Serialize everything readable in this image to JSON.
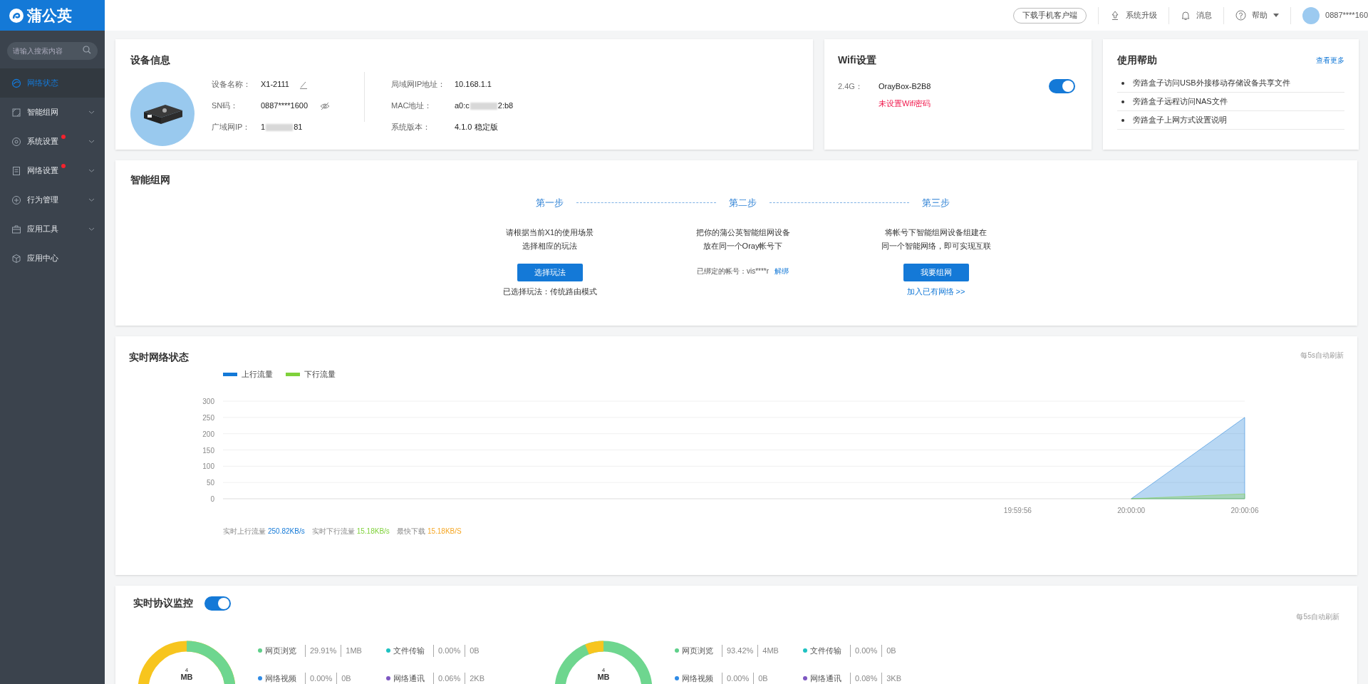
{
  "topbar": {
    "logo": "蒲公英",
    "download_button": "下载手机客户端",
    "upgrade": "系统升级",
    "messages": "消息",
    "help": "帮助",
    "account": "0887****160"
  },
  "sidebar": {
    "search": {
      "placeholder": "请输入搜索内容"
    },
    "items": [
      {
        "label": "网络状态",
        "selected": true,
        "has_submenu": false,
        "dot": false
      },
      {
        "label": "智能组网",
        "selected": false,
        "has_submenu": true,
        "dot": false
      },
      {
        "label": "系统设置",
        "selected": false,
        "has_submenu": true,
        "dot": true
      },
      {
        "label": "网络设置",
        "selected": false,
        "has_submenu": true,
        "dot": true
      },
      {
        "label": "行为管理",
        "selected": false,
        "has_submenu": true,
        "dot": false
      },
      {
        "label": "应用工具",
        "selected": false,
        "has_submenu": true,
        "dot": false
      },
      {
        "label": "应用中心",
        "selected": false,
        "has_submenu": false,
        "dot": false
      }
    ]
  },
  "device_info": {
    "title": "设备信息",
    "fields_left": [
      {
        "label": "设备名称：",
        "value": "X1-2111",
        "kind": "editable"
      },
      {
        "label": "SN码：",
        "value": "0887****1600",
        "kind": "hidden"
      },
      {
        "label": "广域网IP：",
        "value": "1",
        "value_end": "81",
        "kind": "redacted"
      }
    ],
    "fields_right": [
      {
        "label": "局域网IP地址：",
        "value": "10.168.1.1",
        "kind": "plain"
      },
      {
        "label": "MAC地址：",
        "value": "a0:c",
        "value_end": "2:b8",
        "kind": "redacted"
      },
      {
        "label": "系统版本：",
        "value": "4.1.0 稳定版",
        "kind": "plain"
      }
    ]
  },
  "wifi": {
    "title": "Wifi设置",
    "bands": [
      {
        "band": "2.4G：",
        "ssid": "OrayBox-B2B8",
        "on": true,
        "warning": "未设置Wifi密码"
      }
    ]
  },
  "help": {
    "title": "使用帮助",
    "more_link": "查看更多",
    "items": [
      "旁路盒子访问USB外接移动存储设备共享文件",
      "旁路盒子远程访问NAS文件",
      "旁路盒子上网方式设置说明"
    ]
  },
  "smart_network": {
    "title": "智能组网",
    "steps": [
      {
        "title": "第一步",
        "lines": [
          "请根据当前X1的使用场景",
          "选择相应的玩法"
        ],
        "kind": "button",
        "button": "选择玩法",
        "note": "已选择玩法：传统路由模式"
      },
      {
        "title": "第二步",
        "lines": [
          "把你的蒲公英智能组网设备",
          "放在同一个Oray帐号下"
        ],
        "kind": "account",
        "account": "已绑定的帐号：vis****r",
        "link": "解绑"
      },
      {
        "title": "第三步",
        "lines": [
          "将帐号下智能组网设备组建在",
          "同一个智能网络，即可实现互联"
        ],
        "kind": "button",
        "button": "我要组网",
        "link": "加入已有网络 >>"
      }
    ]
  },
  "realtime": {
    "title": "实时网络状态",
    "refresh": "每5s自动刷新",
    "chart_data": {
      "type": "area",
      "categories": [
        null,
        null,
        null,
        null,
        null,
        null,
        null,
        "19:59:56",
        "20:00:00",
        "20:00:06"
      ],
      "series": [
        {
          "name": "上行流量",
          "color": "#1479d7",
          "values": [
            null,
            null,
            null,
            null,
            null,
            null,
            null,
            null,
            0,
            250
          ]
        },
        {
          "name": "下行流量",
          "color": "#7fd13b",
          "values": [
            null,
            null,
            null,
            null,
            null,
            null,
            null,
            null,
            0,
            15
          ]
        }
      ],
      "ylim": [
        0,
        300
      ],
      "yticks": [
        0,
        50,
        100,
        150,
        200,
        250,
        300
      ],
      "grid": true
    },
    "stats": [
      {
        "label": "实时上行流量",
        "value": "250.82KB/s",
        "color": "#1479d7"
      },
      {
        "label": "实时下行流量",
        "value": "15.18KB/s",
        "color": "#7fd13b"
      },
      {
        "label": "最快下载",
        "value": "15.18KB/S",
        "color": "#f5a623"
      }
    ]
  },
  "protocol": {
    "title": "实时协议监控",
    "on": true,
    "refresh": "每5s自动刷新",
    "panels": [
      {
        "center_value": "4",
        "center_unit": "MB",
        "legend": [
          {
            "name": "网页浏览",
            "percent": "29.91%",
            "size": "1MB",
            "color": "#5fd08a"
          },
          {
            "name": "文件传输",
            "percent": "0.00%",
            "size": "0B",
            "color": "#1fc2c2"
          },
          {
            "name": "网络视频",
            "percent": "0.00%",
            "size": "0B",
            "color": "#2f8be6"
          },
          {
            "name": "网络通讯",
            "percent": "0.06%",
            "size": "2KB",
            "color": "#7e57c2"
          }
        ]
      },
      {
        "center_value": "4",
        "center_unit": "MB",
        "legend": [
          {
            "name": "网页浏览",
            "percent": "93.42%",
            "size": "4MB",
            "color": "#5fd08a"
          },
          {
            "name": "文件传输",
            "percent": "0.00%",
            "size": "0B",
            "color": "#1fc2c2"
          },
          {
            "name": "网络视频",
            "percent": "0.00%",
            "size": "0B",
            "color": "#2f8be6"
          },
          {
            "name": "网络通讯",
            "percent": "0.08%",
            "size": "3KB",
            "color": "#7e57c2"
          }
        ]
      }
    ]
  }
}
